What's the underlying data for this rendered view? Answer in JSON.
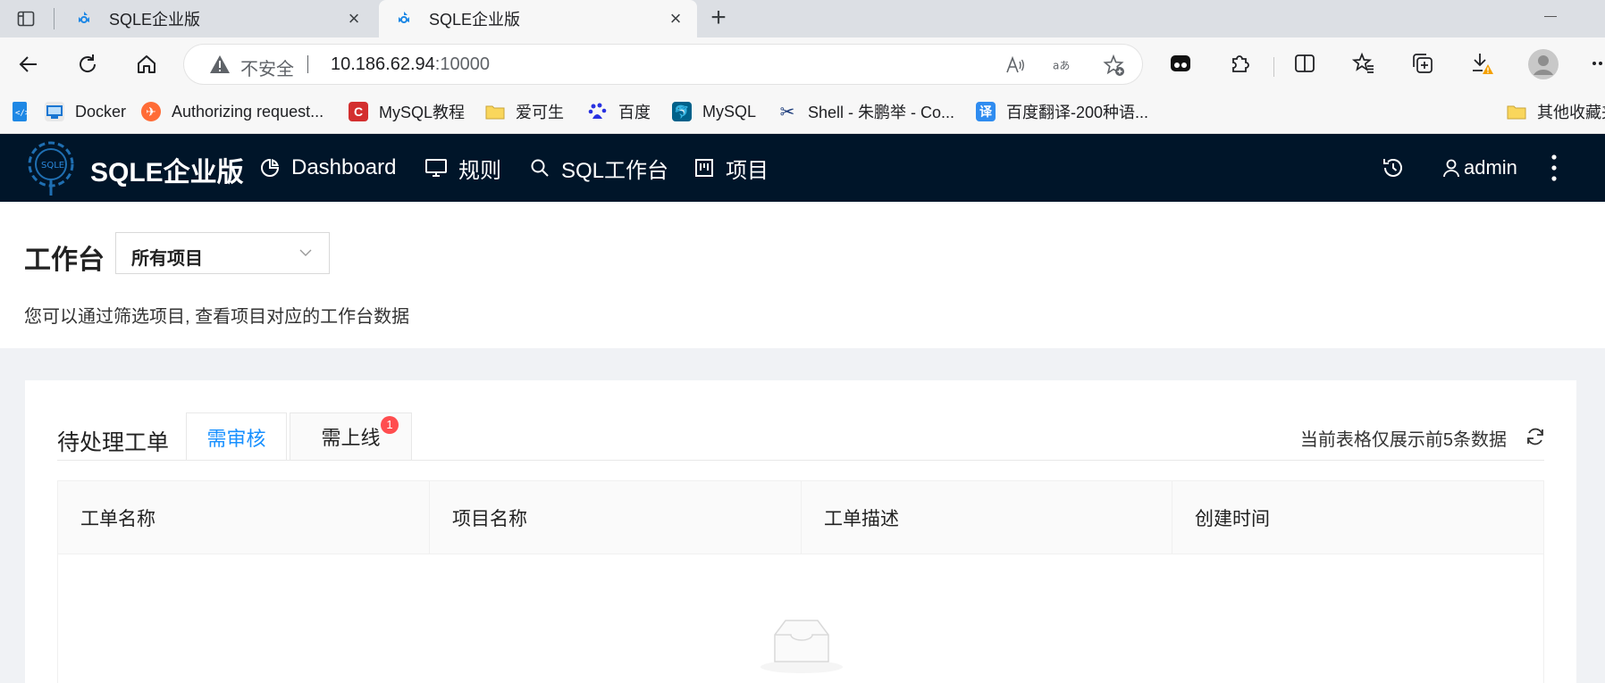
{
  "browser": {
    "tabs": [
      {
        "title": "SQLE企业版"
      },
      {
        "title": "SQLE企业版"
      }
    ],
    "address": {
      "security_label": "不安全",
      "host": "10.186.62.94",
      "port": ":10000"
    },
    "bookmarks": [
      {
        "label": "Docker",
        "icon": "docker-icon"
      },
      {
        "label": "Authorizing request...",
        "icon": "postman-icon"
      },
      {
        "label": "MySQL教程",
        "icon": "c-logo-icon"
      },
      {
        "label": "爱可生",
        "icon": "folder-icon"
      },
      {
        "label": "百度",
        "icon": "baidu-icon"
      },
      {
        "label": "MySQL",
        "icon": "mysql-icon"
      },
      {
        "label": "Shell - 朱鹏举 - Co...",
        "icon": "scissors-icon"
      },
      {
        "label": "百度翻译-200种语...",
        "icon": "translate-icon"
      }
    ],
    "other_bookmarks": "其他收藏夹",
    "colors": {
      "warning": "#f4a000",
      "accent": "#1890ff"
    }
  },
  "app": {
    "brand": "SQLE企业版",
    "logo_text": "SQLE",
    "menu": [
      {
        "label": "Dashboard",
        "icon": "dashboard-icon"
      },
      {
        "label": "规则",
        "icon": "monitor-icon"
      },
      {
        "label": "SQL工作台",
        "icon": "search-icon"
      },
      {
        "label": "项目",
        "icon": "project-icon"
      }
    ],
    "user": "admin",
    "header_bg": "#001529"
  },
  "page": {
    "title": "工作台",
    "project_select": "所有项目",
    "description": "您可以通过筛选项目, 查看项目对应的工作台数据"
  },
  "card": {
    "title": "待处理工单",
    "tabs": [
      {
        "label": "需审核",
        "active": true
      },
      {
        "label": "需上线",
        "badge": "1"
      }
    ],
    "note": "当前表格仅展示前5条数据",
    "columns": [
      "工单名称",
      "项目名称",
      "工单描述",
      "创建时间"
    ]
  }
}
